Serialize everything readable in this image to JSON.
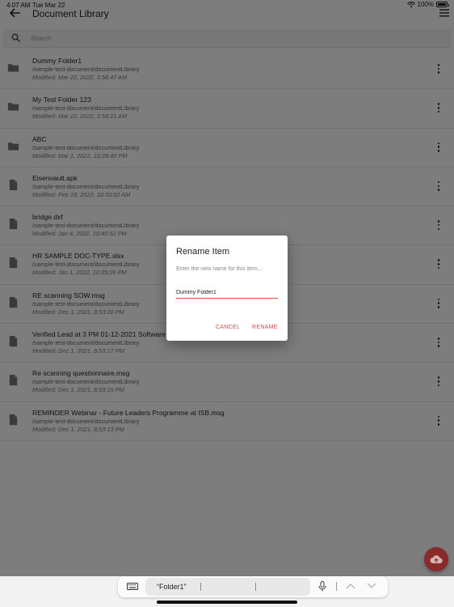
{
  "status": {
    "time": "4:07 AM",
    "date": "Tue Mar 22",
    "battery": "100%"
  },
  "header": {
    "title": "Document Library"
  },
  "search": {
    "placeholder": "Search"
  },
  "items": [
    {
      "name": "Dummy Folder1",
      "path": "/sample-test-document/documentLibrary",
      "modified": "Modified: Mar 22, 2022, 3:58:47 AM",
      "icon": "folder-icon"
    },
    {
      "name": "My Test Folder 123",
      "path": "/sample-test-document/documentLibrary",
      "modified": "Modified: Mar 22, 2022, 3:58:21 AM",
      "icon": "folder-icon"
    },
    {
      "name": "ABC",
      "path": "/sample-test-document/documentLibrary",
      "modified": "Modified: Mar 1, 2022, 10:28:40 PM",
      "icon": "folder-icon"
    },
    {
      "name": "Eisenvault.apk",
      "path": "/sample-test-document/documentLibrary",
      "modified": "Modified: Feb 18, 2022, 10:30:02 AM",
      "icon": "file-icon"
    },
    {
      "name": "bridge.dxf",
      "path": "/sample-test-document/documentLibrary",
      "modified": "Modified: Jan 4, 2022, 10:46:52 PM",
      "icon": "file-icon"
    },
    {
      "name": "HR SAMPLE DOC-TYPE.xlsx",
      "path": "/sample-test-document/documentLibrary",
      "modified": "Modified: Jan 1, 2022, 10:35:26 PM",
      "icon": "file-icon"
    },
    {
      "name": "RE scanning SOW.msg",
      "path": "/sample-test-document/documentLibrary",
      "modified": "Modified: Dec 1, 2021, 8:53:20 PM",
      "icon": "file-icon"
    },
    {
      "name": "Verified Lead at 3 PM 01-12-2021 Software",
      "path": "/sample-test-document/documentLibrary",
      "modified": "Modified: Dec 1, 2021, 8:53:17 PM",
      "icon": "file-icon"
    },
    {
      "name": "Re scanning questionnaire.msg",
      "path": "/sample-test-document/documentLibrary",
      "modified": "Modified: Dec 1, 2021, 8:53:15 PM",
      "icon": "file-icon"
    },
    {
      "name": "REMINDER Webinar - Future Leaders Programme at ISB.msg",
      "path": "/sample-test-document/documentLibrary",
      "modified": "Modified: Dec 1, 2021, 8:53:13 PM",
      "icon": "file-icon"
    }
  ],
  "dialog": {
    "title": "Rename Item",
    "message": "Enter the new name for this item...",
    "value": "Dummy Folder1",
    "cancel_label": "CANCEL",
    "rename_label": "RENAME"
  },
  "keyboard": {
    "suggestion": "“Folder1”"
  },
  "colors": {
    "accent": "#d84a4a",
    "fab": "#8a2a2a"
  }
}
